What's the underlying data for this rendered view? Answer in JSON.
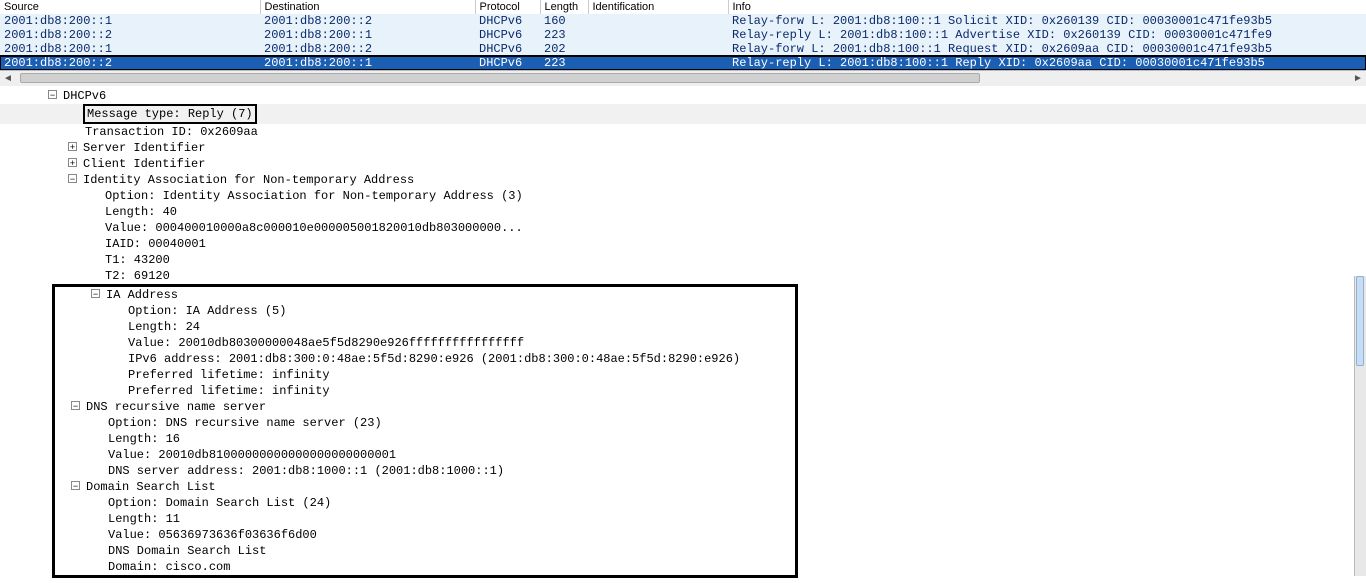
{
  "columns": {
    "source": "Source",
    "destination": "Destination",
    "protocol": "Protocol",
    "length": "Length",
    "identification": "Identification",
    "info": "Info"
  },
  "packets": [
    {
      "src": "2001:db8:200::1",
      "dst": "2001:db8:200::2",
      "proto": "DHCPv6",
      "len": "160",
      "id": "",
      "info": "Relay-forw L: 2001:db8:100::1 Solicit XID: 0x260139 CID: 00030001c471fe93b5",
      "sel": false
    },
    {
      "src": "2001:db8:200::2",
      "dst": "2001:db8:200::1",
      "proto": "DHCPv6",
      "len": "223",
      "id": "",
      "info": "Relay-reply L: 2001:db8:100::1 Advertise XID: 0x260139 CID: 00030001c471fe9",
      "sel": false
    },
    {
      "src": "2001:db8:200::1",
      "dst": "2001:db8:200::2",
      "proto": "DHCPv6",
      "len": "202",
      "id": "",
      "info": "Relay-forw L: 2001:db8:100::1 Request XID: 0x2609aa CID: 00030001c471fe93b5",
      "sel": false
    },
    {
      "src": "2001:db8:200::2",
      "dst": "2001:db8:200::1",
      "proto": "DHCPv6",
      "len": "223",
      "id": "",
      "info": "Relay-reply L: 2001:db8:100::1 Reply XID: 0x2609aa CID: 00030001c471fe93b5",
      "sel": true
    }
  ],
  "details": {
    "root": "DHCPv6",
    "msgtype": "Message type: Reply (7)",
    "xid": "Transaction ID: 0x2609aa",
    "srvid": "Server Identifier",
    "cliid": "Client Identifier",
    "iana": {
      "label": "Identity Association for Non-temporary Address",
      "option": "Option: Identity Association for Non-temporary Address (3)",
      "length": "Length: 40",
      "value": "Value: 000400010000a8c000010e000005001820010db803000000...",
      "iaid": "IAID: 00040001",
      "t1": "T1: 43200",
      "t2": "T2: 69120"
    },
    "iaaddr": {
      "label": "IA Address",
      "option": "Option: IA Address (5)",
      "length": "Length: 24",
      "value": "Value: 20010db80300000048ae5f5d8290e926ffffffffffffffff",
      "addr": "IPv6 address: 2001:db8:300:0:48ae:5f5d:8290:e926 (2001:db8:300:0:48ae:5f5d:8290:e926)",
      "pref1": "Preferred lifetime: infinity",
      "pref2": "Preferred lifetime: infinity"
    },
    "dns": {
      "label": "DNS recursive name server",
      "option": "Option: DNS recursive name server (23)",
      "length": "Length: 16",
      "value": "Value: 20010db81000000000000000000000001",
      "addr": "DNS server address: 2001:db8:1000::1 (2001:db8:1000::1)"
    },
    "dsl": {
      "label": "Domain Search List",
      "option": "Option: Domain Search List (24)",
      "length": "Length: 11",
      "value": "Value: 05636973636f03636f6d00",
      "list": "DNS Domain Search List",
      "domain": "Domain: cisco.com"
    }
  }
}
